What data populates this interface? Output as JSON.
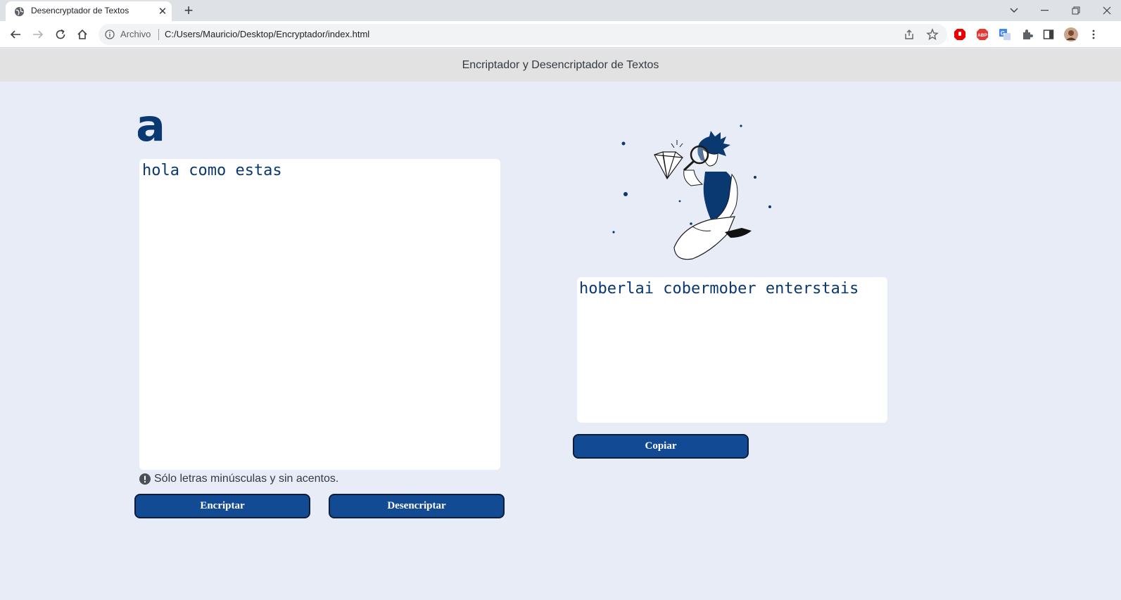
{
  "browser": {
    "tab_title": "Desencryptador de Textos",
    "close_glyph": "✕",
    "new_tab_glyph": "+",
    "site_chip": "Archivo",
    "url": "C:/Users/Mauricio/Desktop/Encryptador/index.html",
    "icons": [
      "back-icon",
      "forward-icon",
      "reload-icon",
      "home-icon",
      "info-icon",
      "share-icon",
      "star-icon",
      "extension-icon",
      "sidepanel-icon",
      "menu-icon"
    ]
  },
  "page": {
    "header_title": "Encriptador y Desencriptador de Textos",
    "input_text": "hola como estas",
    "hint_text": "Sólo letras minúsculas y sin acentos.",
    "encrypt_label": "Encriptar",
    "decrypt_label": "Desencriptar",
    "output_text": "hoberlai cobermober enterstais",
    "copy_label": "Copiar",
    "logo_char": "a"
  },
  "colors": {
    "accent": "#124a93",
    "text": "#0a3871",
    "background": "#e8ecf7"
  }
}
